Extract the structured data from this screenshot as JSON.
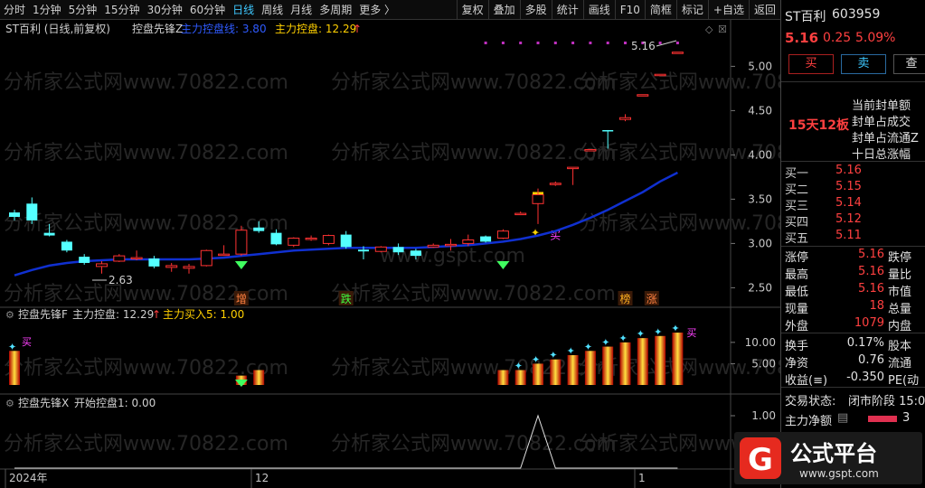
{
  "toolbar": {
    "periods": [
      "分时",
      "1分钟",
      "5分钟",
      "15分钟",
      "30分钟",
      "60分钟",
      "日线",
      "周线",
      "月线",
      "多周期",
      "更多 〉"
    ],
    "active_period": "日线",
    "actions": [
      "复权",
      "叠加",
      "多股",
      "统计",
      "画线",
      "F10",
      "简框",
      "标记",
      "+自选",
      "返回"
    ]
  },
  "main_chart": {
    "title": "ST百利 (日线,前复权)",
    "indicator_name": "控盘先锋Z",
    "indicator_line_label": "主力控盘线: 3.80",
    "indicator_value_label": "主力控盘: 12.29",
    "watermark": "分析家公式网www.70822.com",
    "watermark2": "www.gspt.com",
    "price_high_label": "5.16",
    "price_low_label": "2.63",
    "signal_labels": {
      "zeng": "增",
      "die": "跌",
      "bang": "榜",
      "zhang": "涨",
      "buy": "买"
    }
  },
  "sub1": {
    "indicator_name": "控盘先锋F",
    "label1": "主力控盘: 12.29",
    "label2": "主力买入5: 1.00",
    "buy_label": "买"
  },
  "sub2": {
    "indicator_name": "控盘先锋X",
    "label1": "开始控盘1: 0.00"
  },
  "x_axis": {
    "labels": [
      "2024年",
      "12",
      "1"
    ]
  },
  "right_panel": {
    "stock_name": "ST百利",
    "stock_code": "603959",
    "price": "5.16",
    "change": "0.25",
    "change_pct": "5.09%",
    "buy_button": "买",
    "sell_button": "卖",
    "query_button": "查",
    "streak": "15天12板",
    "info_lines": [
      "当前封单额",
      "封单占成交",
      "封单占流通Z",
      "十日总涨幅"
    ],
    "quotes": [
      {
        "label": "买一",
        "value": "5.16"
      },
      {
        "label": "买二",
        "value": "5.15"
      },
      {
        "label": "买三",
        "value": "5.14"
      },
      {
        "label": "买四",
        "value": "5.12"
      },
      {
        "label": "买五",
        "value": "5.11"
      }
    ],
    "stats": [
      {
        "l1": "涨停",
        "v1": "5.16",
        "l2": "跌停"
      },
      {
        "l1": "最高",
        "v1": "5.16",
        "l2": "量比"
      },
      {
        "l1": "最低",
        "v1": "5.16",
        "l2": "市值"
      },
      {
        "l1": "现量",
        "v1": "18",
        "l2": "总量"
      },
      {
        "l1": "外盘",
        "v1": "1079",
        "l2": "内盘"
      }
    ],
    "stats2": [
      {
        "l1": "换手",
        "v1": "0.17%",
        "l2": "股本"
      },
      {
        "l1": "净资",
        "v1": "0.76",
        "l2": "流通"
      },
      {
        "l1": "收益(≡)",
        "v1": "-0.350",
        "l2": "PE(动"
      }
    ],
    "trade_status_label": "交易状态:",
    "trade_status": "闭市阶段 15:0",
    "net_flow_label": "主力净额",
    "net_flow_value": "3"
  },
  "logo": {
    "text": "公式平台",
    "url": "www.gspt.com"
  },
  "colors": {
    "up": "#ff3232",
    "down": "#54ffff",
    "ma": "#1030d0",
    "gold": "#ffd000"
  },
  "chart_data": {
    "type": "candlestick",
    "y_axis_main": {
      "ticks": [
        "5.00",
        "4.50",
        "4.00",
        "3.50",
        "3.00",
        "2.50"
      ],
      "ylim": [
        2.3,
        5.3
      ]
    },
    "y_axis_sub1": {
      "ticks": [
        "10.00",
        "5.00"
      ]
    },
    "y_axis_sub2": {
      "ticks": [
        "1.00"
      ]
    },
    "candles": [
      {
        "o": 3.35,
        "h": 3.38,
        "l": 3.26,
        "c": 3.3
      },
      {
        "o": 3.45,
        "h": 3.52,
        "l": 3.22,
        "c": 3.26
      },
      {
        "o": 3.12,
        "h": 3.22,
        "l": 3.08,
        "c": 3.09
      },
      {
        "o": 3.02,
        "h": 3.04,
        "l": 2.9,
        "c": 2.92
      },
      {
        "o": 2.85,
        "h": 2.88,
        "l": 2.76,
        "c": 2.78
      },
      {
        "o": 2.74,
        "h": 2.8,
        "l": 2.66,
        "c": 2.77
      },
      {
        "o": 2.8,
        "h": 2.88,
        "l": 2.79,
        "c": 2.86
      },
      {
        "o": 2.83,
        "h": 2.92,
        "l": 2.81,
        "c": 2.84
      },
      {
        "o": 2.83,
        "h": 2.86,
        "l": 2.72,
        "c": 2.74
      },
      {
        "o": 2.73,
        "h": 2.78,
        "l": 2.68,
        "c": 2.75
      },
      {
        "o": 2.72,
        "h": 2.77,
        "l": 2.66,
        "c": 2.74
      },
      {
        "o": 2.75,
        "h": 2.93,
        "l": 2.74,
        "c": 2.92
      },
      {
        "o": 2.88,
        "h": 2.98,
        "l": 2.86,
        "c": 2.88
      },
      {
        "o": 2.88,
        "h": 3.2,
        "l": 2.86,
        "c": 3.15
      },
      {
        "o": 3.18,
        "h": 3.25,
        "l": 3.12,
        "c": 3.14
      },
      {
        "o": 3.12,
        "h": 3.16,
        "l": 2.98,
        "c": 2.99
      },
      {
        "o": 2.98,
        "h": 3.07,
        "l": 2.96,
        "c": 3.06
      },
      {
        "o": 3.06,
        "h": 3.09,
        "l": 3.03,
        "c": 3.06
      },
      {
        "o": 3.0,
        "h": 3.1,
        "l": 2.98,
        "c": 3.09
      },
      {
        "o": 3.1,
        "h": 3.14,
        "l": 2.94,
        "c": 2.96
      },
      {
        "o": 2.93,
        "h": 2.97,
        "l": 2.82,
        "c": 2.91
      },
      {
        "o": 2.91,
        "h": 2.97,
        "l": 2.9,
        "c": 2.96
      },
      {
        "o": 2.96,
        "h": 3.0,
        "l": 2.87,
        "c": 2.9
      },
      {
        "o": 2.92,
        "h": 2.94,
        "l": 2.82,
        "c": 2.86
      },
      {
        "o": 2.96,
        "h": 3.0,
        "l": 2.95,
        "c": 2.98
      },
      {
        "o": 2.98,
        "h": 3.05,
        "l": 2.92,
        "c": 2.99
      },
      {
        "o": 3.0,
        "h": 3.1,
        "l": 2.97,
        "c": 3.04
      },
      {
        "o": 3.08,
        "h": 3.09,
        "l": 3.01,
        "c": 3.02
      },
      {
        "o": 3.06,
        "h": 3.16,
        "l": 3.05,
        "c": 3.14
      },
      {
        "o": 3.33,
        "h": 3.36,
        "l": 3.32,
        "c": 3.34
      },
      {
        "o": 3.45,
        "h": 3.62,
        "l": 3.22,
        "c": 3.55
      },
      {
        "o": 3.68,
        "h": 3.7,
        "l": 3.65,
        "c": 3.68
      },
      {
        "o": 3.86,
        "h": 3.86,
        "l": 3.66,
        "c": 3.86
      },
      {
        "o": 4.06,
        "h": 4.06,
        "l": 4.05,
        "c": 4.06
      },
      {
        "o": 4.28,
        "h": 4.28,
        "l": 4.07,
        "c": 4.27
      },
      {
        "o": 4.4,
        "h": 4.46,
        "l": 4.38,
        "c": 4.42
      },
      {
        "o": 4.68,
        "h": 4.68,
        "l": 4.67,
        "c": 4.68
      },
      {
        "o": 4.91,
        "h": 4.91,
        "l": 4.9,
        "c": 4.91
      },
      {
        "o": 5.16,
        "h": 5.16,
        "l": 5.16,
        "c": 5.16
      }
    ],
    "ma_line": [
      2.64,
      2.7,
      2.75,
      2.78,
      2.8,
      2.81,
      2.82,
      2.82,
      2.82,
      2.82,
      2.82,
      2.83,
      2.84,
      2.86,
      2.88,
      2.9,
      2.92,
      2.93,
      2.94,
      2.95,
      2.95,
      2.95,
      2.95,
      2.95,
      2.96,
      2.97,
      2.98,
      3.0,
      3.02,
      3.05,
      3.09,
      3.14,
      3.21,
      3.29,
      3.38,
      3.48,
      3.58,
      3.7,
      3.8
    ],
    "sub1_bars": [
      8,
      0,
      0,
      0,
      0,
      0,
      0,
      0,
      0,
      0,
      0,
      0,
      0,
      2.2,
      3.5,
      0,
      0,
      0,
      0,
      0,
      0,
      0,
      0,
      0,
      0,
      0,
      0,
      0,
      3.5,
      3.5,
      5,
      6,
      7,
      8,
      9,
      10,
      11,
      11.5,
      12.29
    ],
    "sub2_line": [
      0,
      0,
      0,
      0,
      0,
      0,
      0,
      0,
      0,
      0,
      0,
      0,
      0,
      0,
      0,
      0,
      0,
      0,
      0,
      0,
      0,
      0,
      0,
      0,
      0,
      0,
      0,
      0,
      0,
      0,
      1,
      0,
      0,
      0,
      0,
      0,
      0,
      0,
      0
    ]
  }
}
